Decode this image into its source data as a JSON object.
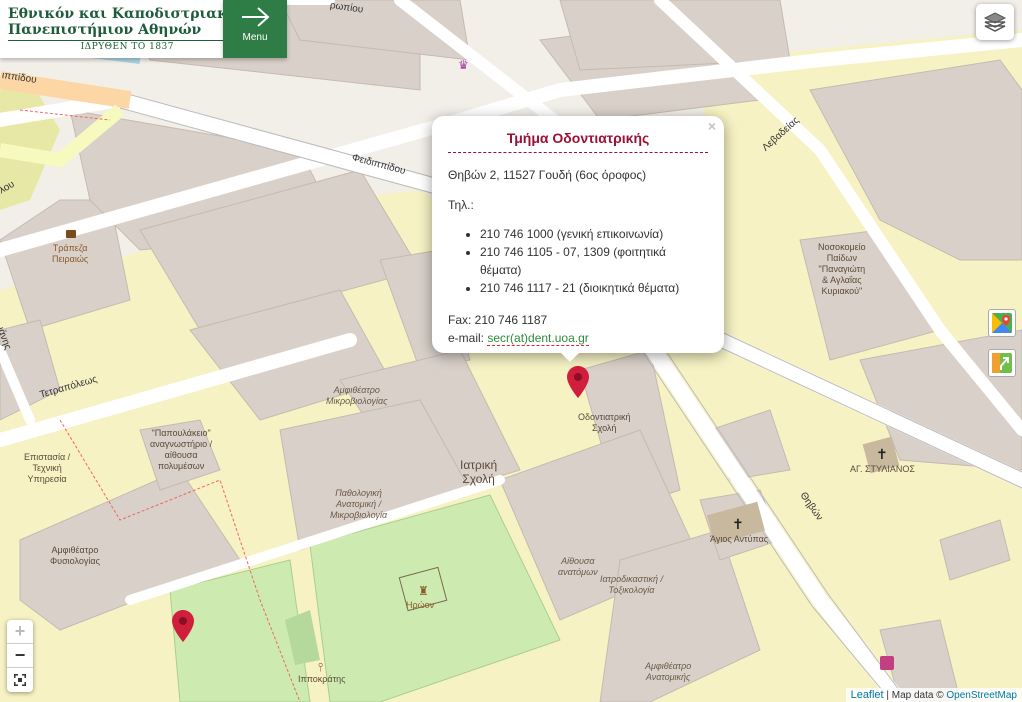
{
  "header": {
    "logo_line1": "Εθνικόν και Καποδιστριακόν",
    "logo_line2": "Πανεπιστήμιον Αθηνών",
    "logo_line3": "ΙΔΡΥΘΕΝ ΤΟ 1837",
    "menu_label": "Menu"
  },
  "popup": {
    "title": "Τμήμα Οδοντιατρικής",
    "address": "Θηβών 2, 11527 Γουδή (6ος όροφος)",
    "phone_label": "Τηλ.:",
    "phones": [
      "210 746 1000 (γενική επικοινωνία)",
      "210 746 1105 - 07, 1309 (φοιτητικά θέματα)",
      "210 746 1117 - 21 (διοικητικά θέματα)"
    ],
    "fax": "Fax: 210 746 1187",
    "email_label": "e-mail:",
    "email": "secr(at)dent.uoa.gr",
    "close": "×"
  },
  "map_labels": {
    "dental_school": "Οδοντιατρική\nΣχολή",
    "medical_school": "Ιατρική\nΣχολή",
    "microbio_amph": "Αμφιθέατρο\nΜικροβιολογίας",
    "papoulakeio": "\"Παπουλάκειο\"\nαναγνωστήριο /\nαίθουσα\nπολυμέσων",
    "technical": "Επιστασία /\nΤεχνική\nΥπηρεσία",
    "physio_amph": "Αμφιθέατρο\nΦυσιολογίας",
    "pathology": "Παθολογική\nΑνατομική /\nΜικροβιολογία",
    "anatomy_halls": "Αίθουσα\nανατόμων",
    "forensic": "Ιατροδικαστική /\nΤοξικολογία",
    "anatomy_amph": "Αμφιθέατρο\nΑνατομικής",
    "heroon": "Ηρώον",
    "hippocrates": "Ιπποκράτης",
    "agios_antypas": "Άγιος Αντύπας",
    "ag_stylianos": "ΑΓ. ΣΤΥΛΙΑΝΟΣ",
    "childrens_hospital": "Νοσοκομείο\nΠαίδων\n\"Παναγιώτη\n& Αγλαΐας\nΚυριακού\"",
    "bank": "Τράπεζα\nΠειραιώς"
  },
  "streets": {
    "feidippidou": "Φειδιππίδου",
    "feidippidou2": "ιππίδου",
    "tetrapoleos": "Τετραπόλεως",
    "thivon": "Θηβών",
    "levadeias": "Λεβαδείας",
    "top": "ρωπίου",
    "left1": "λου",
    "left2": "ιάνης"
  },
  "attribution": {
    "leaflet": "Leaflet",
    "sep": " | Map data © ",
    "osm": "OpenStreetMap"
  },
  "zoom": {
    "in": "+",
    "out": "−"
  }
}
